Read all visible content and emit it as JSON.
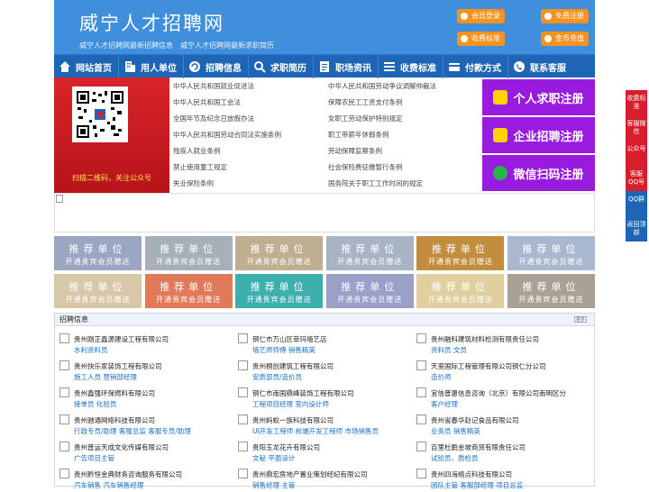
{
  "header": {
    "site_title": "威宁人才招聘网",
    "tagline": "威宁人才招聘网最新招聘信息　威宁人才招聘网最新求职简历",
    "buttons": [
      "会员登录",
      "免费注册",
      "收费标准",
      "金币充值"
    ]
  },
  "nav": [
    "网站首页",
    "用人单位",
    "招聘信息",
    "求职简历",
    "职场资讯",
    "收费标准",
    "付款方式",
    "联系客服"
  ],
  "qr_caption": "扫描二维码，关注公众号",
  "laws": [
    [
      "中华人民共和国就业促进法",
      "中华人民共和国劳动争议调解仲裁法"
    ],
    [
      "中华人民共和国工会法",
      "保障农民工工资支付条例"
    ],
    [
      "全国年节及纪念日放假办法",
      "女职工劳动保护特别规定"
    ],
    [
      "中华人民共和国劳动合同法实施条例",
      "职工带薪年休假条例"
    ],
    [
      "残疾人就业条例",
      "劳动保障监察条例"
    ],
    [
      "禁止使用童工规定",
      "社会保险费征缴暂行条例"
    ],
    [
      "失业保险条例",
      "国务院关于职工工作时间的规定"
    ]
  ],
  "register": [
    "个人求职注册",
    "企业招聘注册",
    "微信扫码注册"
  ],
  "tiles": {
    "title": "推荐单位",
    "subtitle": "开通贵宾会员赠送",
    "colors": [
      "#9aa6c2",
      "#a7b0b9",
      "#bfae8f",
      "#a8b4c4",
      "#c28e3d",
      "#aab8cf",
      "#d9c8a8",
      "#e07a5a",
      "#3dafad",
      "#9aa0c8",
      "#e2cfa0",
      "#a9a294"
    ]
  },
  "jobs": {
    "title": "招聘信息",
    "more": "更多",
    "items": [
      {
        "company": "贵州刚正鑫源建设工程有限公司",
        "positions": "水利资料员"
      },
      {
        "company": "铜仁市万山区菲玛墙艺店",
        "positions": "墙艺师师傅 销售精英"
      },
      {
        "company": "贵州融科建筑材料检测有限责任公司",
        "positions": "资料员 文员"
      },
      {
        "company": "贵州快乐家装饰工程有限公司",
        "positions": "施工人员 营销部经理"
      },
      {
        "company": "贵州桐创建筑工程有限公司",
        "positions": "安质部员/造价员"
      },
      {
        "company": "天垩国际工程管理有限公司铜仁分公司",
        "positions": "造价师"
      },
      {
        "company": "贵州鑫强环保燃料有限公司",
        "positions": "接单员 化验员"
      },
      {
        "company": "铜仁市南国鼎峰装饰工程有限公司",
        "positions": "工程项目经理 室内设计师"
      },
      {
        "company": "宜信普惠信息咨询（北京）有限公司南明区分",
        "positions": "客户经理"
      },
      {
        "company": "贵州驰通网络科技有限公司",
        "positions": "行政专员/助理 客服总监 客服专员/助理"
      },
      {
        "company": "贵州蚂蚁一族科技有限公司",
        "positions": "UI开发工程师 前端开发工程师 市场销售员"
      },
      {
        "company": "贵州省春华赵记食品有限公司",
        "positions": "业务员 销售精英"
      },
      {
        "company": "贵州普运天成文化传媒有限公司",
        "positions": "广告项目主管"
      },
      {
        "company": "贵阳玉龙花卉有限公司",
        "positions": "文秘 平面设计"
      },
      {
        "company": "百里杜鹃金坡商贸有限责任公司",
        "positions": "试验员、质检员"
      },
      {
        "company": "贵州黔恒金典财务咨询服务有限公司",
        "positions": "汽车销售 汽车销售经理"
      },
      {
        "company": "贵州鼎宏房地产置业策划经纪有限公司",
        "positions": "销售经理 主管"
      },
      {
        "company": "贵州四海络点科技有限公司",
        "positions": "团队主管 客服部经理 项目总监"
      }
    ]
  },
  "sidebar": [
    "收费标准",
    "客服微信",
    "公众号",
    "客服QQ号",
    "QQ群",
    "返回顶部"
  ],
  "colors": {
    "primary": "#3f8fdc",
    "nav": "#1e65b5",
    "accent": "#f7921e",
    "register": "#9a1be0",
    "side": "#d81e2d"
  }
}
